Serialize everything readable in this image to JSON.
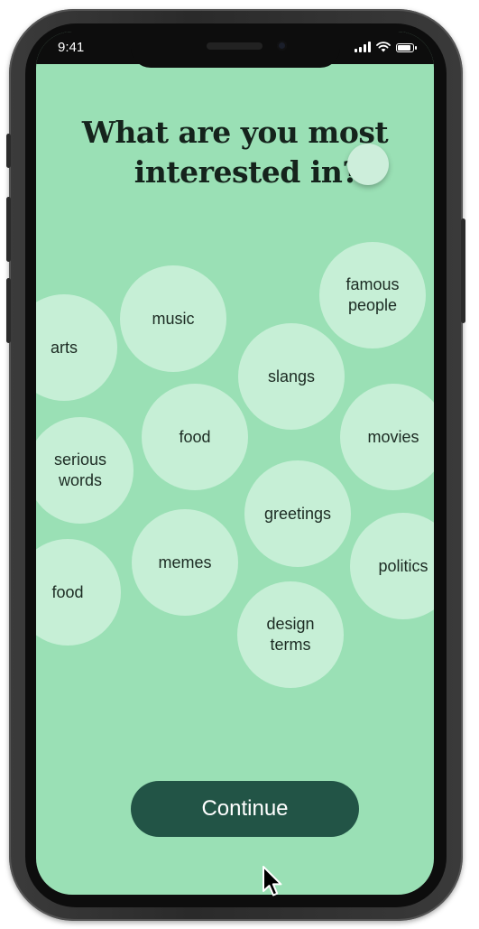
{
  "status_bar": {
    "time": "9:41",
    "icons": [
      "signal-icon",
      "wifi-icon",
      "battery-icon"
    ]
  },
  "screen": {
    "title_line_1": "What are you most",
    "title_line_2": "interested in?",
    "topics": [
      "arts",
      "music",
      "famous\npeople",
      "slangs",
      "food",
      "movies",
      "serious\nwords",
      "greetings",
      "memes",
      "politics",
      "food",
      "design\nterms"
    ],
    "continue_label": "Continue"
  },
  "colors": {
    "background": "#9ae0b5",
    "bubble": "#c6efd6",
    "button": "#225446",
    "title": "#15231c"
  }
}
